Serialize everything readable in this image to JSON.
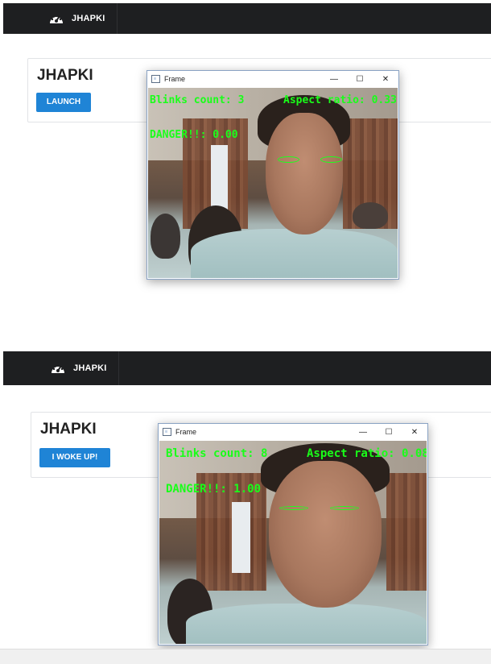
{
  "panels": [
    {
      "navbar": {
        "brand_name": "JHAPKI",
        "brand_icon": "speedometer-icon"
      },
      "card": {
        "title": "JHAPKI",
        "button_label": "LAUNCH"
      },
      "frame_window": {
        "title": "Frame",
        "controls": {
          "minimize": "—",
          "maximize": "☐",
          "close": "✕"
        },
        "overlay": {
          "blinks": "Blinks count: 3",
          "aspect": "Aspect ratio: 0.33",
          "danger": "DANGER!!: 0.00"
        }
      }
    },
    {
      "navbar": {
        "brand_name": "JHAPKI",
        "brand_icon": "speedometer-icon"
      },
      "card": {
        "title": "JHAPKI",
        "button_label": "I WOKE UP!"
      },
      "frame_window": {
        "title": "Frame",
        "controls": {
          "minimize": "—",
          "maximize": "☐",
          "close": "✕"
        },
        "overlay": {
          "blinks": "Blinks count: 8",
          "aspect": "Aspect ratio: 0.08",
          "danger": "DANGER!!: 1.00"
        }
      }
    }
  ],
  "colors": {
    "navbar_bg": "#1e1f21",
    "button_bg": "#1f84d6",
    "overlay_text": "#19ff19"
  }
}
